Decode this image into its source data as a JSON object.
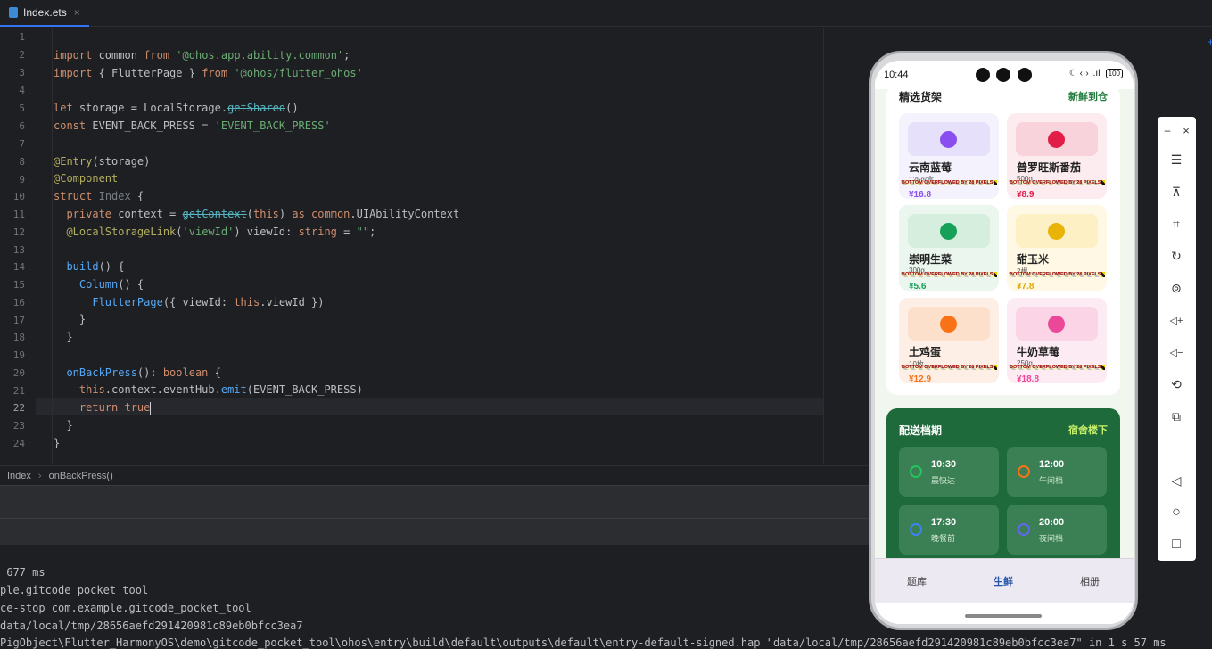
{
  "editor_tab": {
    "filename": "Index.ets",
    "close": "×"
  },
  "code": {
    "lines": [
      "1",
      "2",
      "3",
      "4",
      "5",
      "6",
      "7",
      "8",
      "9",
      "10",
      "11",
      "12",
      "13",
      "14",
      "15",
      "16",
      "17",
      "18",
      "19",
      "20",
      "21",
      "22",
      "23",
      "24"
    ],
    "l2": {
      "a": "import",
      "b": " common ",
      "c": "from",
      "d": " ",
      "e": "'@ohos.app.ability.common'",
      "f": ";"
    },
    "l3": {
      "a": "import",
      "b": " { FlutterPage } ",
      "c": "from",
      "d": " ",
      "e": "'@ohos/flutter_ohos'"
    },
    "l5": {
      "a": "let",
      "b": " storage = LocalStorage.",
      "c": "getShared",
      "d": "()"
    },
    "l6": {
      "a": "const",
      "b": " EVENT_BACK_PRESS = ",
      "c": "'EVENT_BACK_PRESS'"
    },
    "l8": {
      "a": "@Entry",
      "b": "(storage)"
    },
    "l9": {
      "a": "@Component"
    },
    "l10": {
      "a": "struct",
      "b": " ",
      "c": "Index",
      "d": " {"
    },
    "l11": {
      "a": "  private",
      "b": " context = ",
      "c": "getContext",
      "d": "(",
      "e": "this",
      "f": ") ",
      "g": "as",
      "h": " ",
      "i": "common",
      "j": ".UIAbilityContext"
    },
    "l12": {
      "a": "  @LocalStorageLink",
      "b": "(",
      "c": "'viewId'",
      "d": ") viewId: ",
      "e": "string",
      "f": " = ",
      "g": "\"\"",
      "h": ";"
    },
    "l14": {
      "a": "  build",
      "b": "() {"
    },
    "l15": {
      "a": "    Column",
      "b": "() {"
    },
    "l16": {
      "a": "      FlutterPage",
      "b": "({ viewId: ",
      "c": "this",
      "d": ".viewId })"
    },
    "l17": {
      "a": "    }"
    },
    "l18": {
      "a": "  }"
    },
    "l20": {
      "a": "  onBackPress",
      "b": "(): ",
      "c": "boolean",
      "d": " {"
    },
    "l21": {
      "a": "    this",
      "b": ".context.eventHub.",
      "c": "emit",
      "d": "(EVENT_BACK_PRESS)"
    },
    "l22": {
      "a": "    return",
      "b": " ",
      "c": "true"
    },
    "l23": {
      "a": "  }"
    },
    "l24": {
      "a": "}"
    }
  },
  "breadcrumb": {
    "item1": "Index",
    "sep": "›",
    "item2": "onBackPress()"
  },
  "console": [
    " 677 ms",
    "ple.gitcode_pocket_tool",
    "ce-stop com.example.gitcode_pocket_tool",
    "data/local/tmp/28656aefd291420981c89eb0bfcc3ea7",
    "PigObject\\Flutter_HarmonyOS\\demo\\gitcode_pocket_tool\\ohos\\entry\\build\\default\\outputs\\default\\entry-default-signed.hap \"data/local/tmp/28656aefd291420981c89eb0bfcc3ea7\" in 1 s 57 ms"
  ],
  "phone": {
    "status": {
      "time": "10:44",
      "icons": "☾ ‹·› ᵗ.ıll",
      "battery": "100"
    },
    "shelf": {
      "title": "精选货架",
      "link": "新鲜到仓",
      "overflow_text": "BOTTOM OVERFLOWED BY 28 PIXELS",
      "items": [
        {
          "name": "云南蓝莓",
          "spec": "125g/盒",
          "price": "¥16.8",
          "thumb": "#e6e0fb",
          "bg": "#f4f2fd",
          "dot": "#8a4ef0",
          "price_color": "#8a4ef0"
        },
        {
          "name": "普罗旺斯番茄",
          "spec": "500g",
          "price": "¥8.9",
          "thumb": "#f8d3db",
          "bg": "#fcecef",
          "dot": "#e11d48",
          "price_color": "#e11d48"
        },
        {
          "name": "崇明生菜",
          "spec": "300g",
          "price": "¥5.6",
          "thumb": "#d5eede",
          "bg": "#ebf6ef",
          "dot": "#16a058",
          "price_color": "#16a058"
        },
        {
          "name": "甜玉米",
          "spec": "2根",
          "price": "¥7.8",
          "thumb": "#fdf0c4",
          "bg": "#fef8e4",
          "dot": "#eab308",
          "price_color": "#e0a800"
        },
        {
          "name": "土鸡蛋",
          "spec": "10枚",
          "price": "¥12.9",
          "thumb": "#fde0cb",
          "bg": "#fdefe5",
          "dot": "#f97316",
          "price_color": "#f97316"
        },
        {
          "name": "牛奶草莓",
          "spec": "250g",
          "price": "¥18.8",
          "thumb": "#fbd5e6",
          "bg": "#fdebf3",
          "dot": "#ec4899",
          "price_color": "#ec4899"
        }
      ]
    },
    "delivery": {
      "title": "配送档期",
      "link": "宿舍楼下",
      "slots": [
        {
          "time": "10:30",
          "label": "晨快达",
          "clock": "#22c55e"
        },
        {
          "time": "12:00",
          "label": "午间档",
          "clock": "#f97316"
        },
        {
          "time": "17:30",
          "label": "晚餐前",
          "clock": "#3b82f6"
        },
        {
          "time": "20:00",
          "label": "夜间档",
          "clock": "#6366f1"
        }
      ]
    },
    "tabs": {
      "t1": "题库",
      "t2": "生鲜",
      "t3": "相册"
    }
  },
  "toolbar": {
    "minimize": "–",
    "close": "×",
    "menu": "☰",
    "pin": "⊼",
    "crop": "⌗",
    "rotate": "↻",
    "screenshot": "⊚",
    "vol_up": "◁+",
    "vol_down": "◁−",
    "rotate2": "⟲",
    "multi": "⧉",
    "back": "◁",
    "home": "○",
    "recent": "□"
  },
  "edge_mark": "+"
}
